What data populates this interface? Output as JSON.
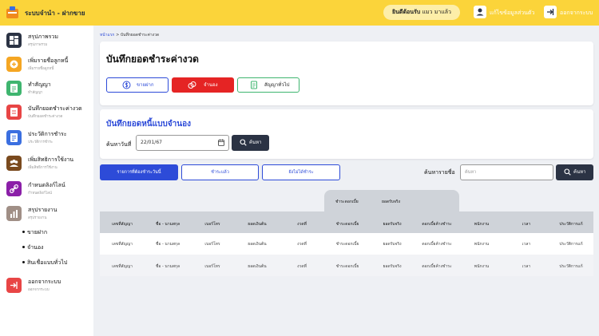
{
  "header": {
    "app_title": "ระบบจำนำ - ฝากขาย",
    "welcome_bold": "ยินดีต้อนรับ",
    "welcome_name": "แมว มาแล้ว",
    "edit_profile": "แก้ไขข้อมูลส่วนตัว",
    "logout": "ออกจากระบบ"
  },
  "sidebar": {
    "items": [
      {
        "label": "สรุปภาพรวม",
        "sub": "สรุปภาพรวม",
        "color": "#2b3344"
      },
      {
        "label": "เพิ่มรายชื่อลูกหนี้",
        "sub": "เพิ่มรายชื่อลูกหนี้",
        "color": "#f5a623"
      },
      {
        "label": "ทำสัญญา",
        "sub": "ทำสัญญา",
        "color": "#3fb56f"
      },
      {
        "label": "บันทึกยอดชำระค่างวด",
        "sub": "บันทึกยอดชำระค่างวด",
        "color": "#e84545"
      },
      {
        "label": "ประวัติการชำระ",
        "sub": "ประวัติการชำระ",
        "color": "#3b6fe0"
      },
      {
        "label": "เพิ่มสิทธิการใช้งาน",
        "sub": "เพิ่มสิทธิการใช้งาน",
        "color": "#7a4a1e"
      },
      {
        "label": "กำหนดลิงก์ไลน์",
        "sub": "กำหนดลิงก์ไลน์",
        "color": "#8b1fa8"
      },
      {
        "label": "สรุปรายงาน",
        "sub": "สรุปรายงาน",
        "color": "#a08f86"
      }
    ],
    "subitems": [
      "ขายฝาก",
      "จำนอง",
      "สินเชื่อแบบทั่วไป"
    ],
    "logout": {
      "label": "ออกจากระบบ",
      "sub": "ออกจากระบบ",
      "color": "#e84545"
    }
  },
  "breadcrumb": {
    "home": "หน้าแรก",
    "sep": ">",
    "current": "บันทึกยอดชำระค่างวด"
  },
  "page_title": "บันทึกยอดชำระค่างวด",
  "modes": [
    {
      "label": "ขายฝาก"
    },
    {
      "label": "จำนอง"
    },
    {
      "label": "สัญญาทั่วไป"
    }
  ],
  "section": {
    "title": "บันทึกยอดหนี้แบบจำนอง",
    "date_label": "ค้นหาวันที่",
    "date_value": "22/01/67",
    "search_btn": "ค้นหา"
  },
  "filters": {
    "tabs": [
      "รายการที่ต้องชำระวันนี้",
      "ชำระแล้ว",
      "ยังไม่ได้ชำระ"
    ],
    "search_label": "ค้นหารายชื่อ",
    "search_placeholder": "ค้นหา",
    "search_btn": "ค้นหา"
  },
  "table": {
    "group_headers": [
      "ชำระดอกเบี้ย",
      "ยอดรับจริง"
    ],
    "headers": [
      "เลขที่สัญญา",
      "ชื่อ - นามสกุล",
      "เบอร์โทร",
      "ยอดเงินต้น",
      "งวดที่",
      "ชำระดอกเบี้ย",
      "ยอดรับจริง",
      "ดอกเบี้ยค้างชำระ",
      "พนักงาน",
      "เวลา",
      "ประวัติการแก้"
    ],
    "rows": [
      [
        "เลขที่สัญญา",
        "ชื่อ - นามสกุล",
        "เบอร์โทร",
        "ยอดเงินต้น",
        "งวดที่",
        "ชำระดอกเบี้ย",
        "ยอดรับจริง",
        "ดอกเบี้ยค้างชำระ",
        "พนักงาน",
        "เวลา",
        "ประวัติการแก้"
      ],
      [
        "เลขที่สัญญา",
        "ชื่อ - นามสกุล",
        "เบอร์โทร",
        "ยอดเงินต้น",
        "งวดที่",
        "ชำระดอกเบี้ย",
        "ยอดรับจริง",
        "ดอกเบี้ยค้างชำระ",
        "พนักงาน",
        "เวลา",
        "ประวัติการแก้"
      ]
    ]
  },
  "colors": {
    "accent": "#2d4bd8",
    "topbar": "#fbd43a",
    "danger": "#e84545",
    "success": "#3fb56f",
    "dark": "#2b3344"
  }
}
